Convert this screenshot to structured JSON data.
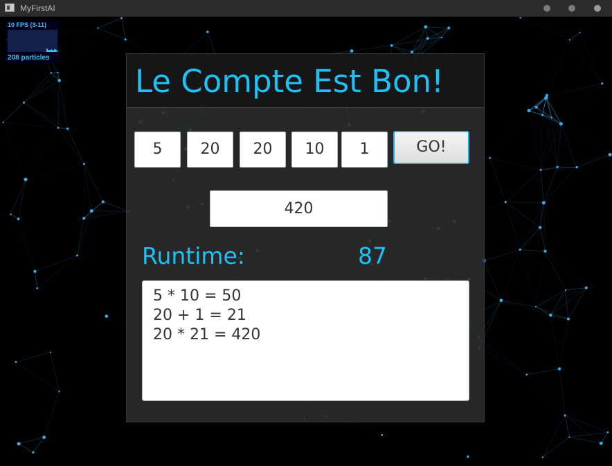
{
  "window": {
    "title": "MyFirstAI"
  },
  "fps_overlay": {
    "fps_label": "10 FPS (3-11)",
    "particles_label": "208 particles"
  },
  "app": {
    "title": "Le Compte Est Bon!",
    "numbers": [
      "5",
      "20",
      "20",
      "10",
      "1"
    ],
    "go_label": "GO!",
    "target": "420",
    "runtime_label": "Runtime:",
    "runtime_value": "87",
    "solution_lines": [
      "5 * 10 = 50",
      "20 + 1 = 21",
      "20 * 21 = 420"
    ]
  },
  "colors": {
    "accent": "#1ec0f5",
    "background": "#000000",
    "panel": "#2c2c2c",
    "particle": "#3fa9e8"
  }
}
